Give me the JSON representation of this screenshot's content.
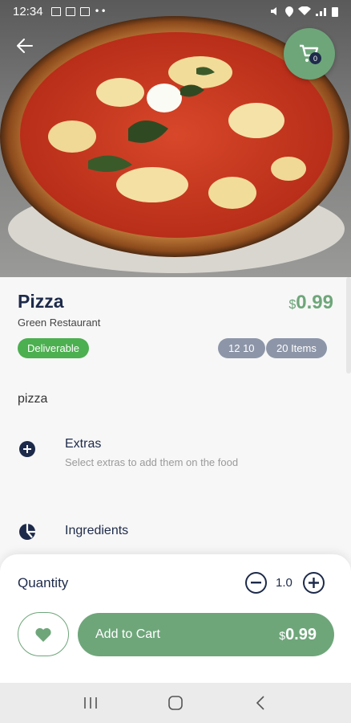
{
  "status_bar": {
    "time": "12:34"
  },
  "product": {
    "name": "Pizza",
    "restaurant": "Green Restaurant",
    "price_currency": "$",
    "price_amount": "0.99",
    "deliverable_label": "Deliverable",
    "time_chip": "12 10",
    "items_chip": "20 Items",
    "description": "pizza"
  },
  "cart": {
    "count": "0",
    "icon": "cart-icon"
  },
  "sections": {
    "extras": {
      "title": "Extras",
      "subtitle": "Select extras to add them on the food",
      "icon": "add-circle-icon"
    },
    "ingredients": {
      "title": "Ingredients",
      "icon": "pie-chart-icon"
    }
  },
  "bottom_sheet": {
    "quantity_label": "Quantity",
    "quantity_value": "1.0",
    "add_to_cart_label": "Add to Cart",
    "total_currency": "$",
    "total_amount": "0.99"
  },
  "colors": {
    "accent_green": "#6ea67a",
    "deliverable_green": "#4caf50",
    "chip_gray": "#8d96a8",
    "text_dark": "#1d2a4a"
  }
}
